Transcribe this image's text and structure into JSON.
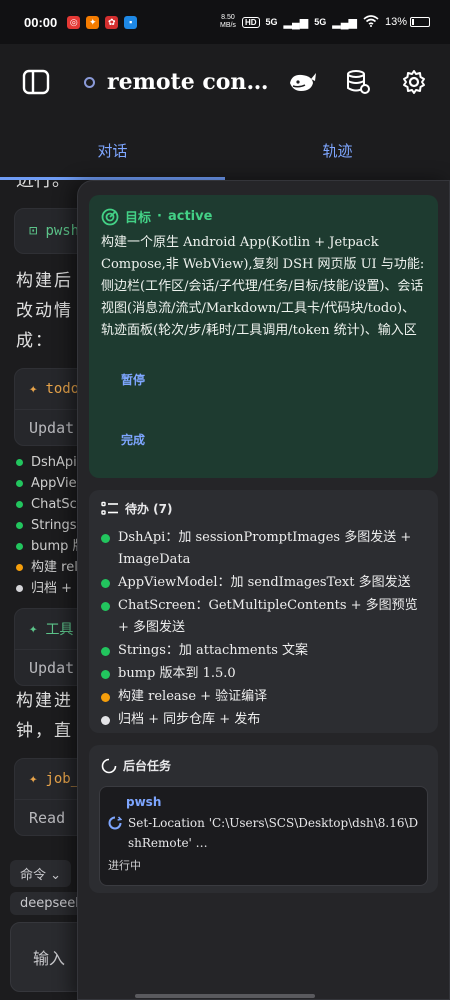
{
  "status_bar": {
    "time": "00:00",
    "speed": "8.50\nMB/s",
    "hd": "HD",
    "signal1": "5G",
    "signal2": "5G",
    "battery": "13%",
    "battery_level": 0.13
  },
  "header": {
    "title": "remote cont …"
  },
  "tabs": [
    {
      "label": "对话",
      "active": true
    },
    {
      "label": "轨迹",
      "active": false
    }
  ],
  "conversation": {
    "cut_text": "进行。",
    "card1_label": "pwsh",
    "para1": "构建后 改动情 成：",
    "card2_label": "todo",
    "card2_body": "Updat",
    "list": [
      {
        "text": "DshApi",
        "color": "#22c55e"
      },
      {
        "text": "AppVie",
        "color": "#22c55e"
      },
      {
        "text": "ChatSc",
        "color": "#22c55e"
      },
      {
        "text": "Strings",
        "color": "#22c55e"
      },
      {
        "text": "bump 版",
        "color": "#22c55e"
      },
      {
        "text": "构建 rel",
        "color": "#f59e0b"
      },
      {
        "text": "归档 +",
        "color": "#d4d4d8"
      }
    ],
    "card3_label": "工具",
    "card3_body": "Updat",
    "para2": "构建进 钟，直",
    "card4_label": "job_",
    "card4_body": "Read",
    "cmd_chip": "命令",
    "model_chip": "deepseek",
    "input_placeholder": "输入"
  },
  "goal": {
    "label": "目标",
    "status": "active",
    "text": "构建一个原生 Android App(Kotlin + Jetpack Compose,非 WebView),复刻 DSH 网页版 UI 与功能:侧边栏(工作区/会话/子代理/任务/目标/技能/设置)、会话视图(消息流/流式/Markdown/工具卡/代码块/todo)、轨迹面板(轮次/步/耗时/工具调用/token 统计)、输入区(模型选择/推理强度/…",
    "pause_label": "暂停",
    "complete_label": "完成"
  },
  "todos": {
    "title": "待办 (7)",
    "items": [
      {
        "text": "DshApi：加 sessionPromptImages 多图发送 + ImageData",
        "color": "#22c55e"
      },
      {
        "text": "AppViewModel：加 sendImagesText 多图发送",
        "color": "#22c55e"
      },
      {
        "text": "ChatScreen：GetMultipleContents + 多图预览 + 多图发送",
        "color": "#22c55e"
      },
      {
        "text": "Strings：加 attachments 文案",
        "color": "#22c55e"
      },
      {
        "text": "bump 版本到 1.5.0",
        "color": "#22c55e"
      },
      {
        "text": "构建 release + 验证编译",
        "color": "#f59e0b"
      },
      {
        "text": "归档 + 同步仓库 + 发布",
        "color": "#e4e4e7"
      }
    ]
  },
  "background_tasks": {
    "title": "后台任务",
    "task": {
      "name": "pwsh",
      "command": "Set-Location 'C:\\Users\\SCS\\Desktop\\dsh\\8.16\\DshRemote' …",
      "status": "进行中"
    }
  }
}
